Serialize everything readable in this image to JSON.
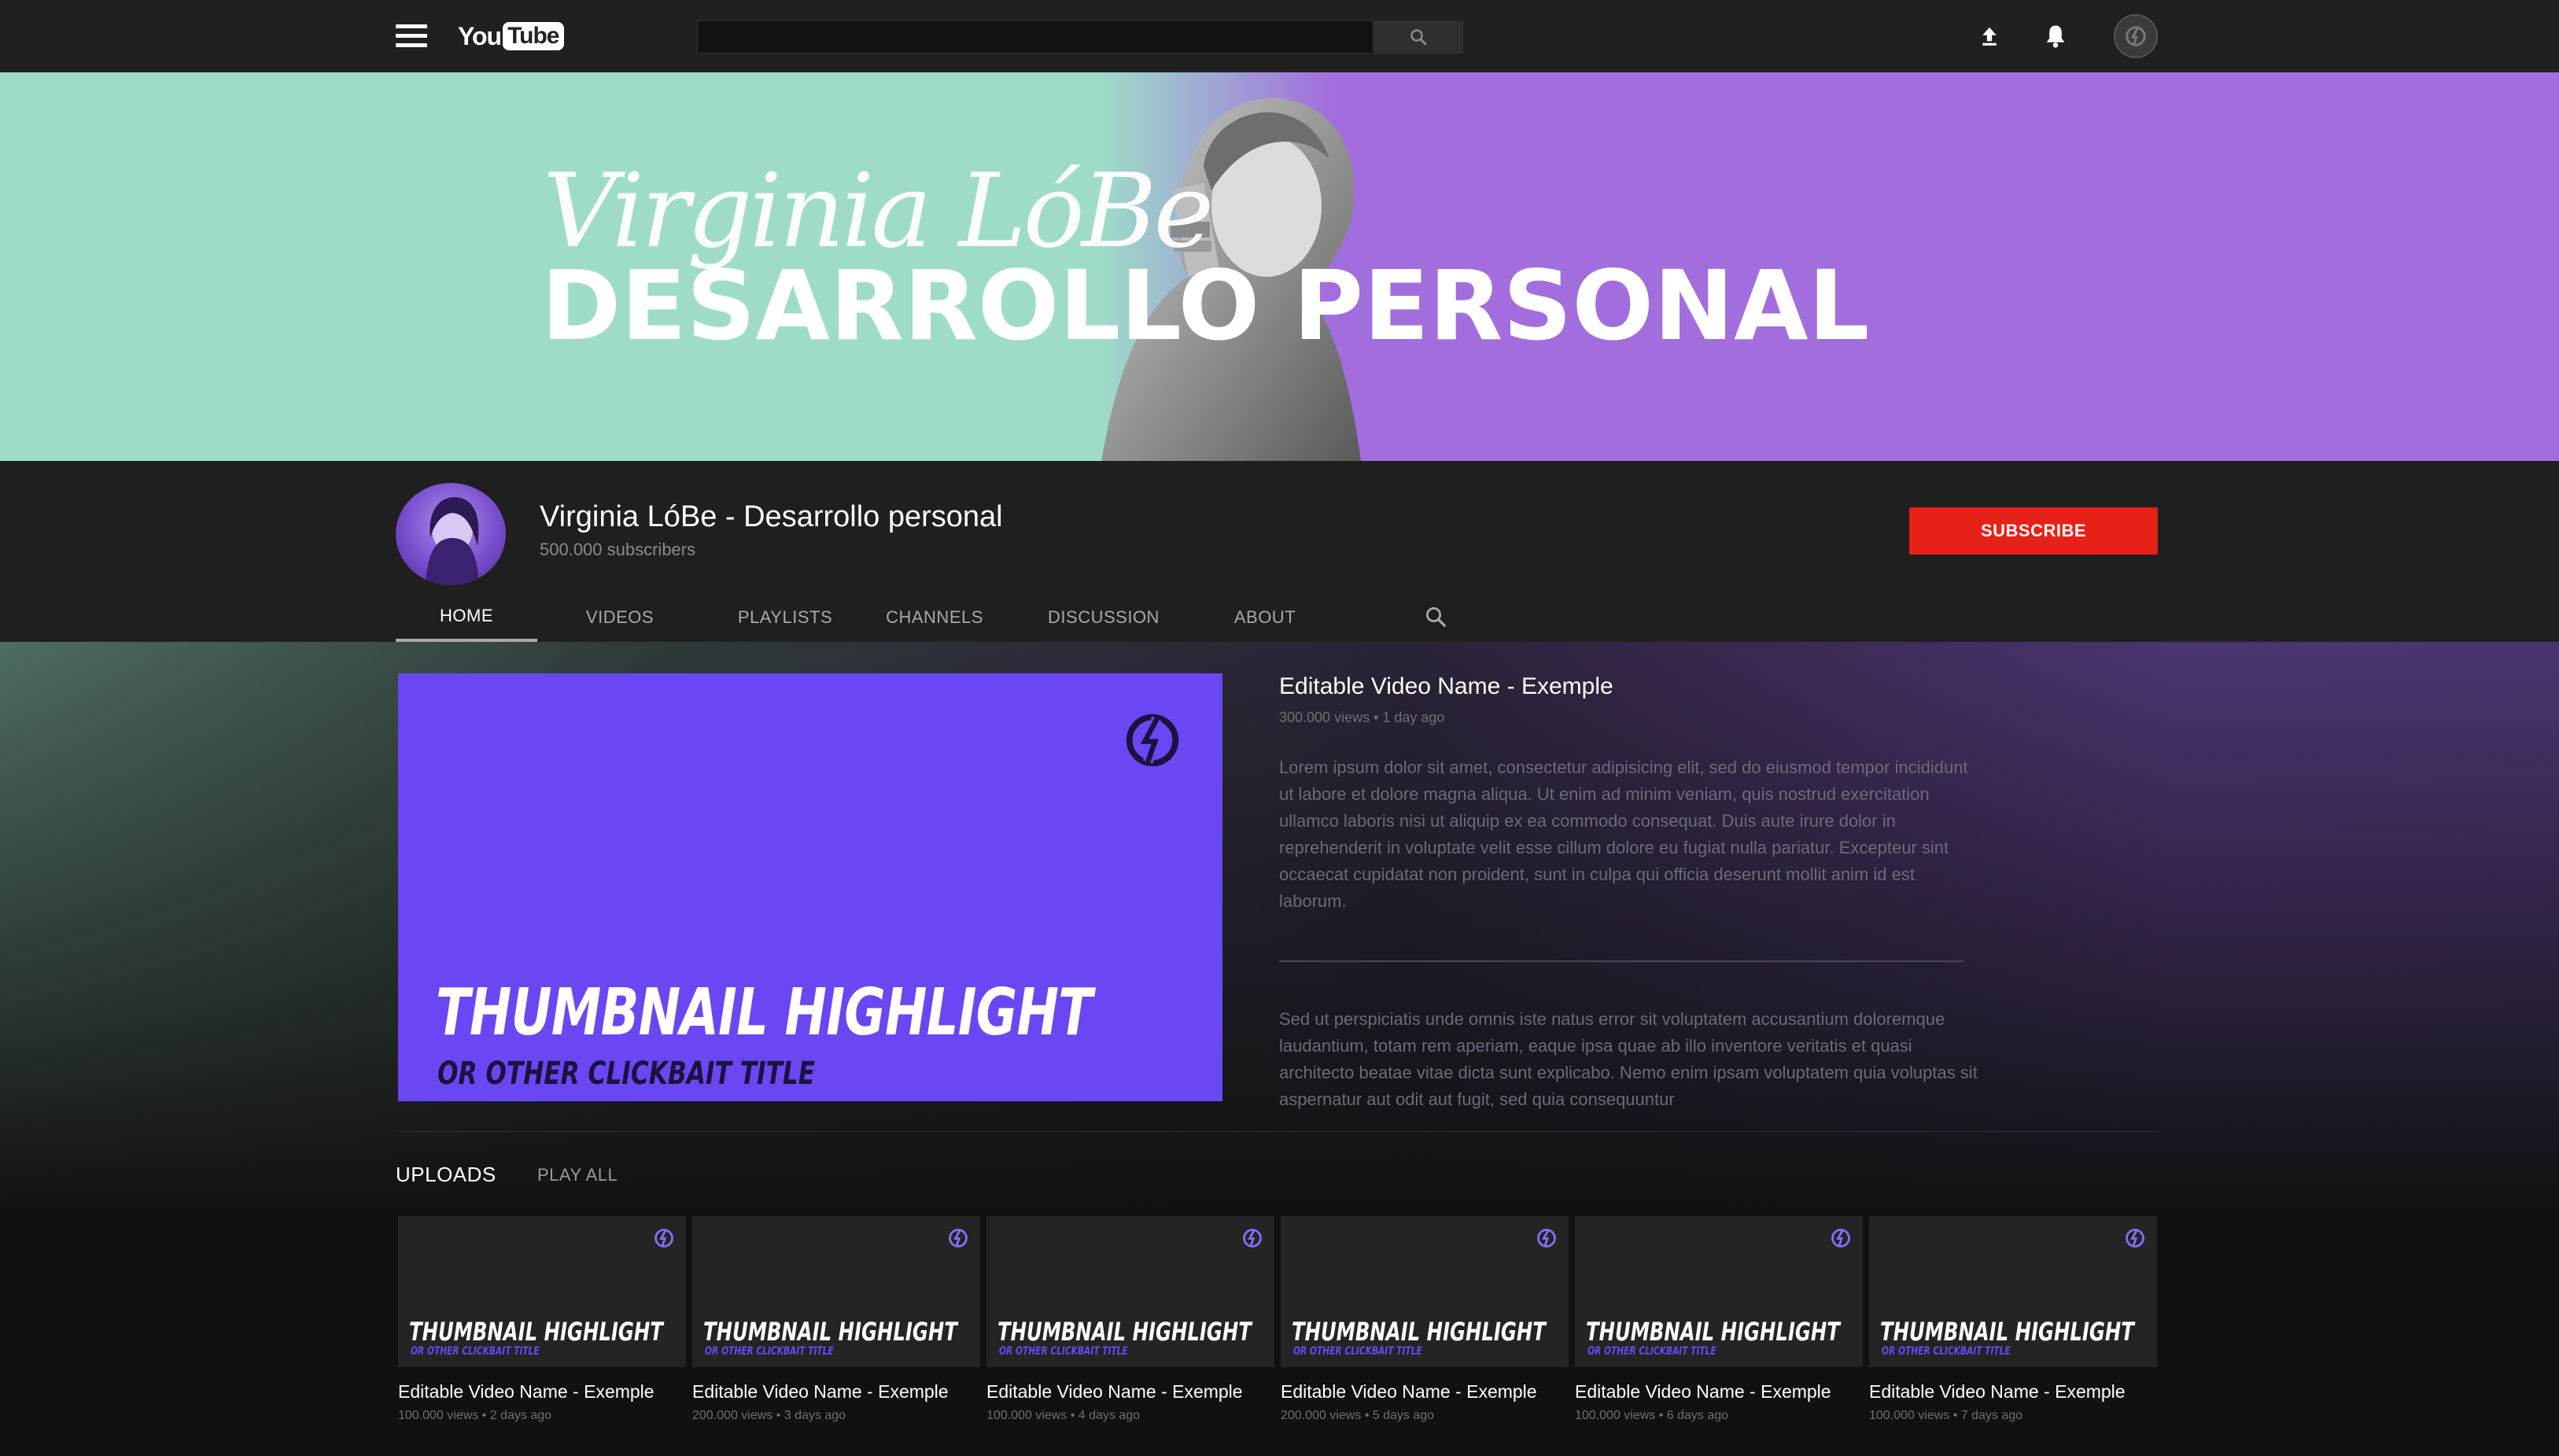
{
  "topbar": {
    "logo_you": "You",
    "logo_tube": "Tube",
    "search_placeholder": ""
  },
  "banner": {
    "script_name": "Virginia LóBe",
    "title": "DESARROLLO PERSONAL"
  },
  "channel": {
    "name": "Virginia LóBe - Desarrollo personal",
    "subscribers": "500.000 subscribers",
    "subscribe_label": "SUBSCRIBE"
  },
  "tabs": [
    {
      "label": "HOME",
      "active": true
    },
    {
      "label": "VIDEOS",
      "active": false
    },
    {
      "label": "PLAYLISTS",
      "active": false
    },
    {
      "label": "CHANNELS",
      "active": false
    },
    {
      "label": "DISCUSSION",
      "active": false
    },
    {
      "label": "ABOUT",
      "active": false
    }
  ],
  "featured": {
    "thumb_title": "THUMBNAIL HIGHLIGHT",
    "thumb_subtitle": "OR OTHER CLICKBAIT TITLE",
    "title": "Editable Video Name - Exemple",
    "meta": "300.000 views • 1 day ago",
    "description_1": "Lorem ipsum dolor sit amet, consectetur adipisicing elit, sed do eiusmod tempor incididunt ut labore et dolore magna aliqua. Ut enim ad minim veniam, quis nostrud exercitation ullamco laboris nisi ut aliquip ex ea commodo consequat. Duis aute irure dolor in reprehenderit in voluptate velit esse cillum dolore eu fugiat nulla pariatur. Excepteur sint occaecat cupidatat non proident, sunt in culpa qui officia deserunt mollit anim id est laborum.",
    "description_2": "Sed ut perspiciatis unde omnis iste natus error sit voluptatem accusantium doloremque laudantium, totam rem aperiam, eaque ipsa quae ab illo inventore veritatis et quasi architecto beatae vitae dicta sunt explicabo. Nemo enim ipsam voluptatem quia voluptas sit aspernatur aut odit aut fugit, sed quia consequuntur"
  },
  "uploads": {
    "label": "UPLOADS",
    "play_all": "PLAY ALL",
    "items": [
      {
        "thumb_title": "THUMBNAIL HIGHLIGHT",
        "thumb_subtitle": "OR OTHER CLICKBAIT TITLE",
        "title": "Editable Video Name - Exemple",
        "meta": "100.000 views • 2 days ago"
      },
      {
        "thumb_title": "THUMBNAIL HIGHLIGHT",
        "thumb_subtitle": "OR OTHER CLICKBAIT TITLE",
        "title": "Editable Video Name - Exemple",
        "meta": "200.000 views • 3 days ago"
      },
      {
        "thumb_title": "THUMBNAIL HIGHLIGHT",
        "thumb_subtitle": "OR OTHER CLICKBAIT TITLE",
        "title": "Editable Video Name - Exemple",
        "meta": "100.000 views • 4 days ago"
      },
      {
        "thumb_title": "THUMBNAIL HIGHLIGHT",
        "thumb_subtitle": "OR OTHER CLICKBAIT TITLE",
        "title": "Editable Video Name - Exemple",
        "meta": "200.000 views • 5 days ago"
      },
      {
        "thumb_title": "THUMBNAIL HIGHLIGHT",
        "thumb_subtitle": "OR OTHER CLICKBAIT TITLE",
        "title": "Editable Video Name - Exemple",
        "meta": "100.000 views • 6 days ago"
      },
      {
        "thumb_title": "THUMBNAIL HIGHLIGHT",
        "thumb_subtitle": "OR OTHER CLICKBAIT TITLE",
        "title": "Editable Video Name - Exemple",
        "meta": "100.000 views • 7 days ago"
      }
    ]
  },
  "icons": {
    "menu": "menu-icon",
    "search": "search-icon",
    "upload": "upload-icon",
    "notifications": "bell-icon",
    "account": "account-avatar"
  },
  "colors": {
    "topbar": "#202020",
    "banner_left": "#9edcc8",
    "banner_right": "#a26ede",
    "subscribe": "#e62117",
    "thumbnail_purple": "#6a47f2"
  }
}
